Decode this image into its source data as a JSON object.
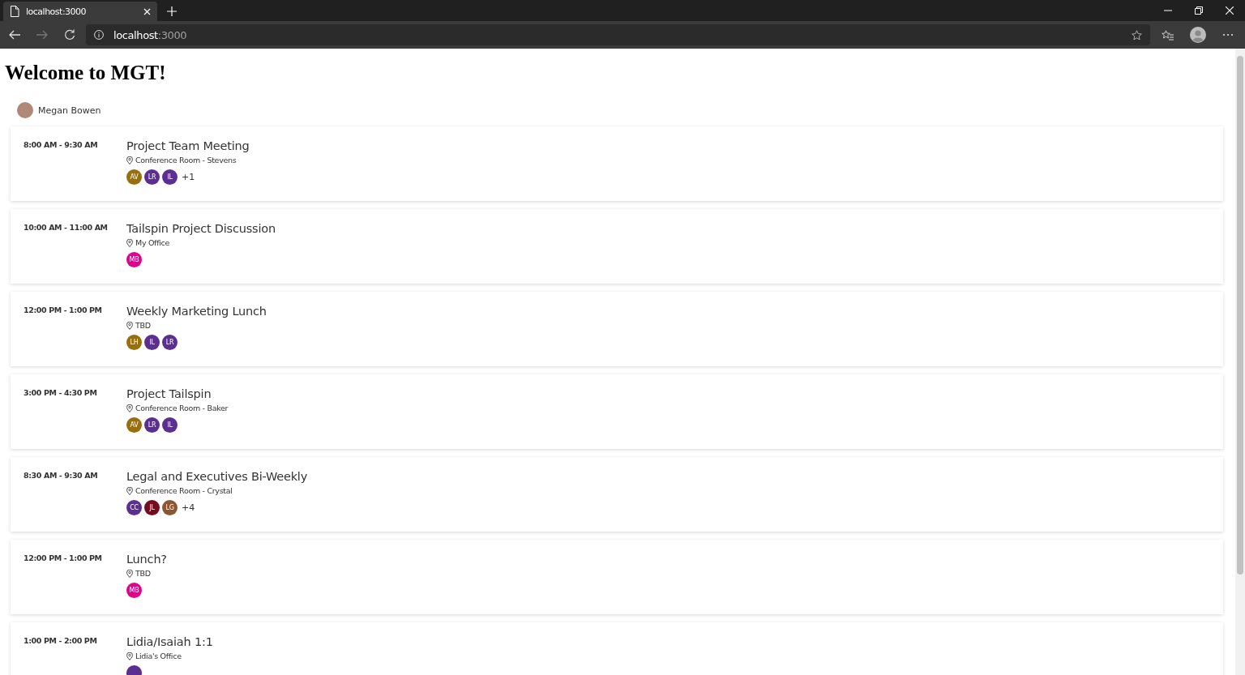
{
  "browser": {
    "tab_title": "localhost:3000",
    "address_host": "localhost",
    "address_port": ":3000"
  },
  "heading": "Welcome to MGT!",
  "person": {
    "name": "Megan Bowen"
  },
  "events": [
    {
      "time": "8:00 AM - 9:30 AM",
      "subject": "Project Team Meeting",
      "location": "Conference Room - Stevens",
      "attendees": [
        {
          "initials": "AV",
          "color": "#986f0b"
        },
        {
          "initials": "LR",
          "color": "#5c2e91"
        },
        {
          "initials": "IL",
          "color": "#5c2e91"
        }
      ],
      "more": "+1"
    },
    {
      "time": "10:00 AM - 11:00 AM",
      "subject": "Tailspin Project Discussion",
      "location": "My Office",
      "attendees": [
        {
          "initials": "MB",
          "color": "#e3008c"
        }
      ]
    },
    {
      "time": "12:00 PM - 1:00 PM",
      "subject": "Weekly Marketing Lunch",
      "location": "TBD",
      "attendees": [
        {
          "initials": "LH",
          "color": "#986f0b"
        },
        {
          "initials": "IL",
          "color": "#5c2e91"
        },
        {
          "initials": "LR",
          "color": "#5c2e91"
        }
      ]
    },
    {
      "time": "3:00 PM - 4:30 PM",
      "subject": "Project Tailspin",
      "location": "Conference Room - Baker",
      "attendees": [
        {
          "initials": "AV",
          "color": "#986f0b"
        },
        {
          "initials": "LR",
          "color": "#5c2e91"
        },
        {
          "initials": "IL",
          "color": "#5c2e91"
        }
      ]
    },
    {
      "time": "8:30 AM - 9:30 AM",
      "subject": "Legal and Executives Bi-Weekly",
      "location": "Conference Room - Crystal",
      "attendees": [
        {
          "initials": "CC",
          "color": "#5c2e91"
        },
        {
          "initials": "JL",
          "color": "#750b1c"
        },
        {
          "initials": "LG",
          "color": "#8e562e"
        }
      ],
      "more": "+4"
    },
    {
      "time": "12:00 PM - 1:00 PM",
      "subject": "Lunch?",
      "location": "TBD",
      "attendees": [
        {
          "initials": "MB",
          "color": "#e3008c"
        }
      ]
    },
    {
      "time": "1:00 PM - 2:00 PM",
      "subject": "Lidia/Isaiah 1:1",
      "location": "Lidia's Office",
      "attendees": [
        {
          "color": "#5c2e91"
        }
      ]
    }
  ]
}
